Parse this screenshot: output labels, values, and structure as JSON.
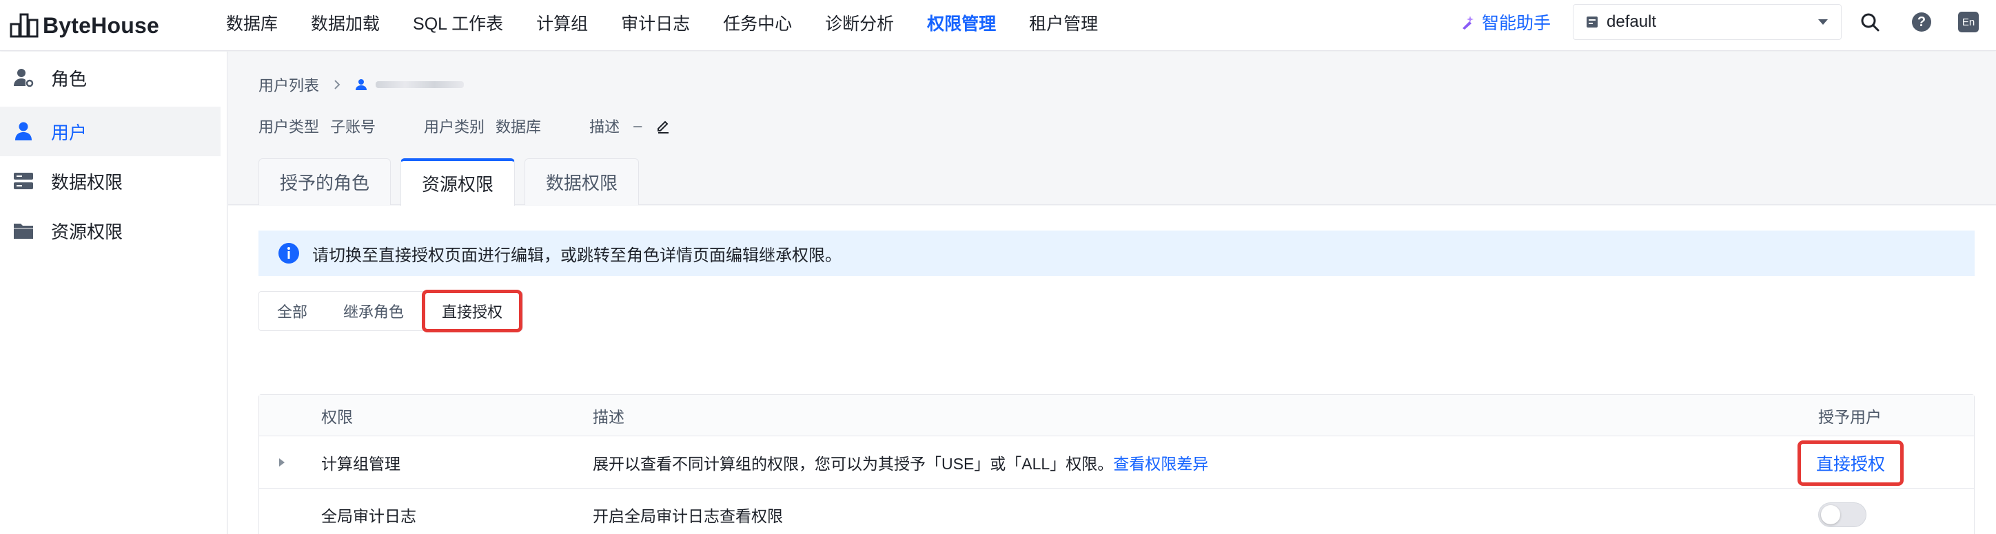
{
  "app": {
    "logo_text": "ByteHouse"
  },
  "nav": {
    "items": [
      "数据库",
      "数据加载",
      "SQL 工作表",
      "计算组",
      "审计日志",
      "任务中心",
      "诊断分析",
      "权限管理",
      "租户管理"
    ],
    "active_index": 7
  },
  "topbar": {
    "assistant_label": "智能助手",
    "workspace_value": "default",
    "lang_label": "En",
    "help_label": "?"
  },
  "sidebar": {
    "items": [
      {
        "label": "角色",
        "icon": "user-settings-icon"
      },
      {
        "label": "用户",
        "icon": "user-icon"
      },
      {
        "label": "数据权限",
        "icon": "server-icon"
      },
      {
        "label": "资源权限",
        "icon": "folder-icon"
      }
    ],
    "active_index": 1
  },
  "breadcrumb": {
    "root": "用户列表"
  },
  "meta": {
    "user_type_label": "用户类型",
    "user_type_value": "子账号",
    "user_category_label": "用户类别",
    "user_category_value": "数据库",
    "desc_label": "描述",
    "desc_value": "–"
  },
  "tabs": {
    "items": [
      "授予的角色",
      "资源权限",
      "数据权限"
    ],
    "active_index": 1
  },
  "banner": {
    "text": "请切换至直接授权页面进行编辑，或跳转至角色详情页面编辑继承权限。"
  },
  "segment": {
    "items": [
      "全部",
      "继承角色",
      "直接授权"
    ],
    "active_index": 2
  },
  "table": {
    "headers": {
      "perm": "权限",
      "desc": "描述",
      "grant": "授予用户"
    },
    "rows": [
      {
        "perm": "计算组管理",
        "desc": "展开以查看不同计算组的权限，您可以为其授予「USE」或「ALL」权限。",
        "desc_link": "查看权限差异",
        "grant_link": "直接授权"
      },
      {
        "perm": "全局审计日志",
        "desc": "开启全局审计日志查看权限",
        "toggle_on": false
      }
    ]
  },
  "colors": {
    "accent": "#1664ff",
    "highlight": "#e53935"
  }
}
